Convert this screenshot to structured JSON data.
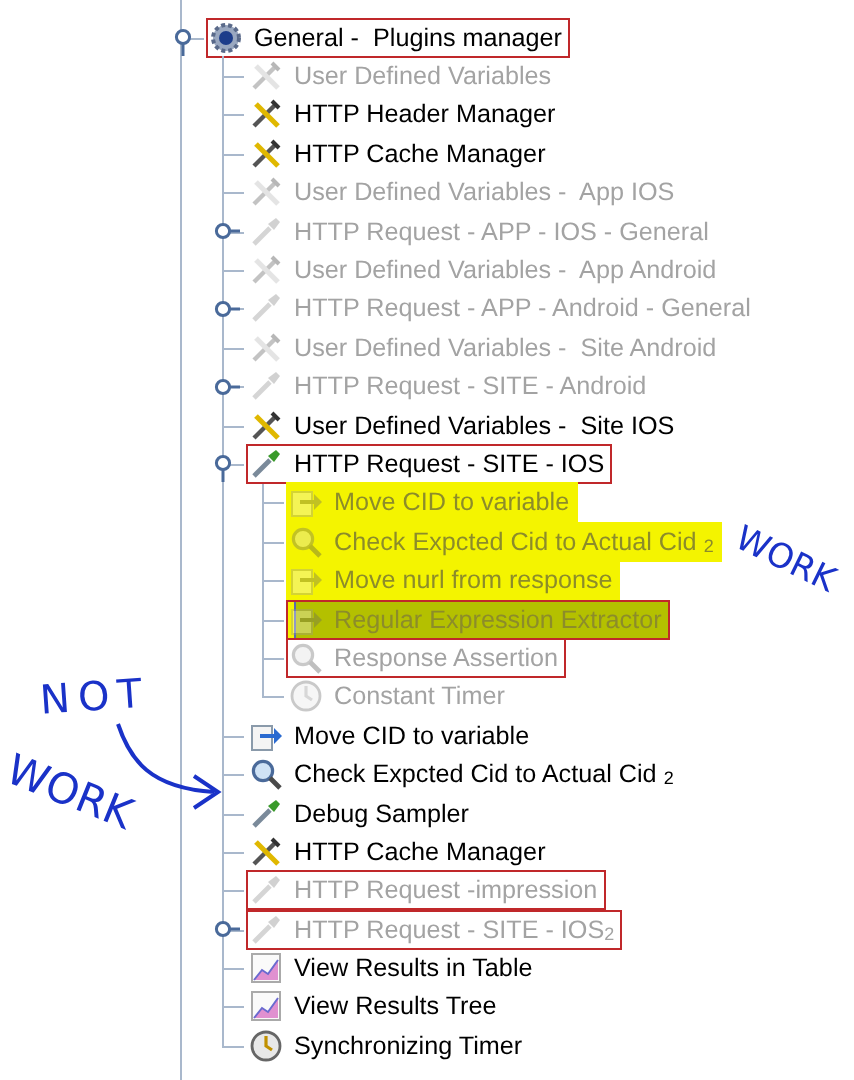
{
  "tree": [
    {
      "label": "General -  Plugins manager",
      "kind": "gear",
      "enabled": true,
      "selected": false,
      "highlighted": false,
      "boxed": true,
      "expanded": true,
      "children": [
        {
          "label": "User Defined Variables",
          "kind": "config",
          "enabled": false,
          "selected": false,
          "highlighted": false,
          "boxed": false
        },
        {
          "label": "HTTP Header Manager",
          "kind": "config",
          "enabled": true,
          "selected": false,
          "highlighted": false,
          "boxed": false
        },
        {
          "label": "HTTP Cache Manager",
          "kind": "config",
          "enabled": true,
          "selected": false,
          "highlighted": false,
          "boxed": false
        },
        {
          "label": "User Defined Variables -  App IOS",
          "kind": "config",
          "enabled": false,
          "selected": false,
          "highlighted": false,
          "boxed": false
        },
        {
          "label": "HTTP Request - APP - IOS - General",
          "kind": "sampler",
          "enabled": false,
          "selected": false,
          "highlighted": false,
          "boxed": false,
          "expanded": false
        },
        {
          "label": "User Defined Variables -  App Android",
          "kind": "config",
          "enabled": false,
          "selected": false,
          "highlighted": false,
          "boxed": false
        },
        {
          "label": "HTTP Request - APP - Android - General",
          "kind": "sampler",
          "enabled": false,
          "selected": false,
          "highlighted": false,
          "boxed": false,
          "expanded": false
        },
        {
          "label": "User Defined Variables -  Site Android",
          "kind": "config",
          "enabled": false,
          "selected": false,
          "highlighted": false,
          "boxed": false
        },
        {
          "label": "HTTP Request - SITE - Android",
          "kind": "sampler",
          "enabled": false,
          "selected": false,
          "highlighted": false,
          "boxed": false,
          "expanded": false
        },
        {
          "label": "User Defined Variables -  Site IOS",
          "kind": "config",
          "enabled": true,
          "selected": false,
          "highlighted": false,
          "boxed": false
        },
        {
          "label": "HTTP Request - SITE - IOS",
          "kind": "sampler",
          "enabled": true,
          "selected": false,
          "highlighted": false,
          "boxed": true,
          "expanded": true,
          "children": [
            {
              "label": "Move CID to variable",
              "kind": "extractor",
              "enabled": false,
              "selected": false,
              "highlighted": true,
              "boxed": false
            },
            {
              "label": "Check Expcted Cid to Actual Cid $_{2}$",
              "kind": "assertion",
              "enabled": false,
              "selected": false,
              "highlighted": true,
              "boxed": false
            },
            {
              "label": "Move nurl from response",
              "kind": "extractor",
              "enabled": false,
              "selected": false,
              "highlighted": true,
              "boxed": false
            },
            {
              "label": "Regular Expression Extractor",
              "kind": "extractor",
              "enabled": false,
              "selected": true,
              "highlighted": true,
              "boxed": true
            },
            {
              "label": "Response Assertion",
              "kind": "assertion",
              "enabled": false,
              "selected": false,
              "highlighted": false,
              "boxed": true
            },
            {
              "label": "Constant Timer",
              "kind": "timer",
              "enabled": false,
              "selected": false,
              "highlighted": false,
              "boxed": false
            }
          ]
        },
        {
          "label": "Move CID to variable",
          "kind": "extractor",
          "enabled": true,
          "selected": false,
          "highlighted": false,
          "boxed": false
        },
        {
          "label": "Check Expcted Cid to Actual Cid $_{2}$",
          "kind": "assertion",
          "enabled": true,
          "selected": false,
          "highlighted": false,
          "boxed": false
        },
        {
          "label": "Debug Sampler",
          "kind": "sampler",
          "enabled": true,
          "selected": false,
          "highlighted": false,
          "boxed": false
        },
        {
          "label": "HTTP Cache Manager",
          "kind": "config",
          "enabled": true,
          "selected": false,
          "highlighted": false,
          "boxed": false
        },
        {
          "label": "HTTP Request -impression",
          "kind": "sampler",
          "enabled": false,
          "selected": false,
          "highlighted": false,
          "boxed": true
        },
        {
          "label": "HTTP Request - SITE - IOS$_{2}$",
          "kind": "sampler",
          "enabled": false,
          "selected": false,
          "highlighted": false,
          "boxed": true,
          "expanded": false
        },
        {
          "label": "View Results in Table",
          "kind": "listener",
          "enabled": true,
          "selected": false,
          "highlighted": false,
          "boxed": false
        },
        {
          "label": "View Results Tree",
          "kind": "listener",
          "enabled": true,
          "selected": false,
          "highlighted": false,
          "boxed": false
        },
        {
          "label": "Synchronizing Timer",
          "kind": "timer",
          "enabled": true,
          "selected": false,
          "highlighted": false,
          "boxed": false
        }
      ]
    }
  ],
  "notes": {
    "left": [
      "NOT",
      "WORK"
    ],
    "right": "WORK"
  }
}
